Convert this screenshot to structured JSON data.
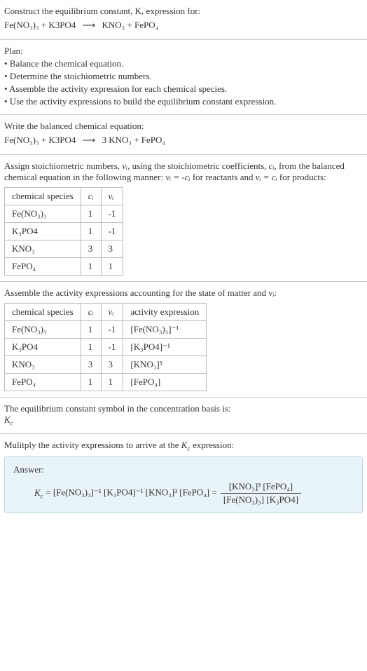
{
  "header": {
    "prompt": "Construct the equilibrium constant, K, expression for:",
    "equation_lhs1": "Fe(NO₃)₃",
    "plus": "+",
    "equation_lhs2": "K3PO4",
    "arrow": "⟶",
    "equation_rhs1": "KNO₃",
    "equation_rhs2": "FePO₄"
  },
  "plan": {
    "title": "Plan:",
    "items": [
      "• Balance the chemical equation.",
      "• Determine the stoichiometric numbers.",
      "• Assemble the activity expression for each chemical species.",
      "• Use the activity expressions to build the equilibrium constant expression."
    ]
  },
  "balanced": {
    "title": "Write the balanced chemical equation:",
    "lhs1": "Fe(NO₃)₃",
    "lhs2": "K3PO4",
    "coef": "3",
    "rhs1": "KNO₃",
    "rhs2": "FePO₄"
  },
  "stoich": {
    "intro_a": "Assign stoichiometric numbers, ",
    "nu_i": "νᵢ",
    "intro_b": ", using the stoichiometric coefficients, ",
    "c_i": "cᵢ",
    "intro_c": ", from the balanced chemical equation in the following manner: ",
    "rel1": "νᵢ = -cᵢ",
    "intro_d": " for reactants and ",
    "rel2": "νᵢ = cᵢ",
    "intro_e": " for products:",
    "headers": [
      "chemical species",
      "cᵢ",
      "νᵢ"
    ],
    "rows": [
      [
        "Fe(NO₃)₃",
        "1",
        "-1"
      ],
      [
        "K₃PO4",
        "1",
        "-1"
      ],
      [
        "KNO₃",
        "3",
        "3"
      ],
      [
        "FePO₄",
        "1",
        "1"
      ]
    ]
  },
  "activity": {
    "intro": "Assemble the activity expressions accounting for the state of matter and νᵢ:",
    "headers": [
      "chemical species",
      "cᵢ",
      "νᵢ",
      "activity expression"
    ],
    "rows": [
      [
        "Fe(NO₃)₃",
        "1",
        "-1",
        "[Fe(NO₃)₃]⁻¹"
      ],
      [
        "K₃PO4",
        "1",
        "-1",
        "[K₃PO4]⁻¹"
      ],
      [
        "KNO₃",
        "3",
        "3",
        "[KNO₃]³"
      ],
      [
        "FePO₄",
        "1",
        "1",
        "[FePO₄]"
      ]
    ]
  },
  "symbol": {
    "line1": "The equilibrium constant symbol in the concentration basis is:",
    "kc": "K_c"
  },
  "multiply": {
    "intro": "Mulitply the activity expressions to arrive at the Kc expression:"
  },
  "answer": {
    "label": "Answer:",
    "kc": "K_c",
    "eq": " = ",
    "t1": "[Fe(NO₃)₃]⁻¹",
    "t2": "[K₃PO4]⁻¹",
    "t3": "[KNO₃]³",
    "t4": "[FePO₄]",
    "eq2": " = ",
    "num1": "[KNO₃]³",
    "num2": "[FePO₄]",
    "den1": "[Fe(NO₃)₃]",
    "den2": "[K₃PO4]"
  }
}
